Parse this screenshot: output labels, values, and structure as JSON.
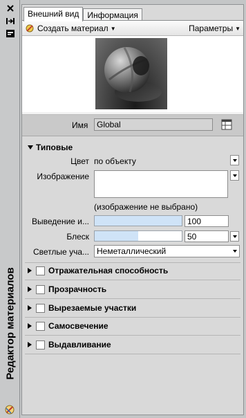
{
  "sidebar": {
    "title": "Редактор материалов",
    "icons": [
      "close-icon",
      "pin-icon",
      "properties-icon",
      "material-icon"
    ]
  },
  "tabs": [
    {
      "label": "Внешний вид",
      "active": true
    },
    {
      "label": "Информация",
      "active": false
    }
  ],
  "toolbar": {
    "create_label": "Создать материал",
    "params_label": "Параметры"
  },
  "name_row": {
    "label": "Имя",
    "value": "Global"
  },
  "generic": {
    "header": "Типовые",
    "color_label": "Цвет",
    "color_value": "по объекту",
    "image_label": "Изображение",
    "image_note": "(изображение не выбрано)",
    "fade_label": "Выведение и...",
    "fade_value": "100",
    "fade_level": 1.0,
    "gloss_label": "Блеск",
    "gloss_value": "50",
    "gloss_level": 0.5,
    "highlights_label": "Светлые уча...",
    "highlights_value": "Неметаллический"
  },
  "sections": [
    {
      "label": "Отражательная способность"
    },
    {
      "label": "Прозрачность"
    },
    {
      "label": "Вырезаемые участки"
    },
    {
      "label": "Самосвечение"
    },
    {
      "label": "Выдавливание"
    }
  ],
  "colors": {
    "panel_bg": "#d9d9d9",
    "slider_fill": "#cfe3f7",
    "name_row_bg": "#c9c9c9"
  }
}
